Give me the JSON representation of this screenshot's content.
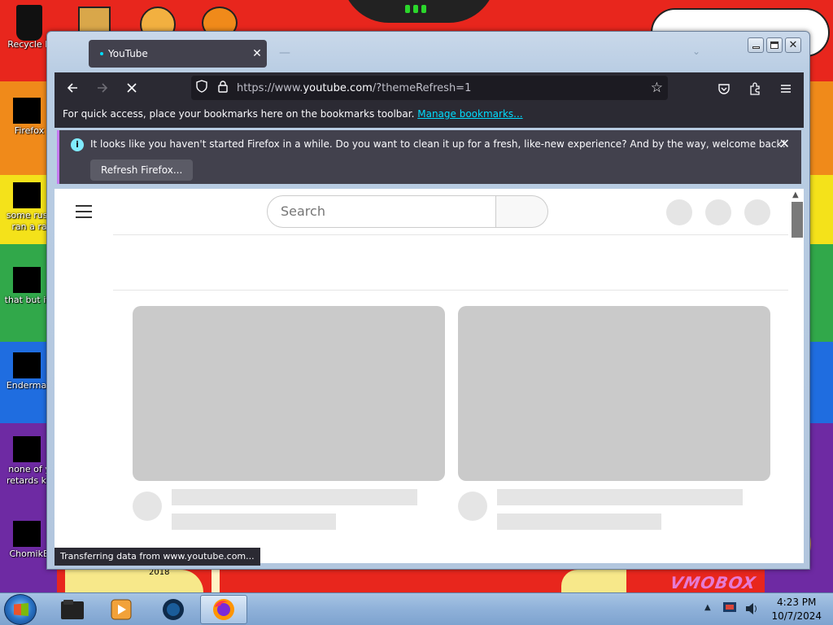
{
  "desktop": {
    "icons": [
      {
        "label": "Recycle B"
      },
      {
        "label": "Firefox"
      },
      {
        "label": "some russ",
        "label2": "ran a ra"
      },
      {
        "label": "that but its"
      },
      {
        "label": "Enderman"
      },
      {
        "label": "none of y",
        "label2": "retards kn"
      },
      {
        "label": "ChomikB"
      }
    ],
    "year_text": "2018",
    "watermark_text": "VMOBOX"
  },
  "browser": {
    "window_controls": {
      "minimize": "minimize",
      "maximize": "maximize",
      "close": "close"
    },
    "tab": {
      "title": "YouTube",
      "close_icon": "close-icon"
    },
    "navbar": {
      "url_prefix": "https://www.",
      "url_host": "youtube.com",
      "url_suffix": "/?themeRefresh=1"
    },
    "bookmarks_bar": {
      "text": "For quick access, place your bookmarks here on the bookmarks toolbar.",
      "link": "Manage bookmarks..."
    },
    "notification": {
      "message": "It looks like you haven't started Firefox in a while. Do you want to clean it up for a fresh, like-new experience? And by the way, welcome back!",
      "button": "Refresh Firefox..."
    },
    "status_text": "Transferring data from www.youtube.com..."
  },
  "youtube": {
    "search_placeholder": "Search"
  },
  "taskbar": {
    "clock_time": "4:23 PM",
    "clock_date": "10/7/2024"
  },
  "colors": {
    "ff_dark": "#2b2a33",
    "ff_tab": "#42414d",
    "ff_accent": "#00ddff",
    "skeleton": "#e5e5e5",
    "thumb_skeleton": "#cacaca"
  }
}
